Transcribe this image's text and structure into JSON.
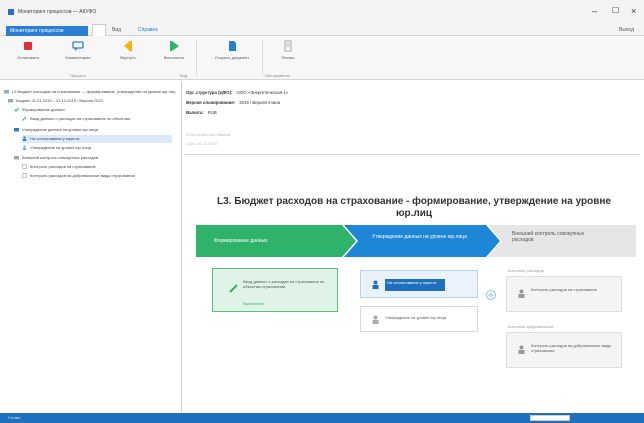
{
  "window": {
    "title": "Мониторинг процессов — АКУФО",
    "min_glyph": "–",
    "max_glyph": "☐",
    "close_glyph": "×"
  },
  "tabs": {
    "file": "Мониторинг процессов",
    "active": "",
    "view": "Вид",
    "help": "Справка",
    "right": "Выход"
  },
  "ribbon": {
    "buttons": [
      {
        "label": "Остановить",
        "icon": "stop-icon"
      },
      {
        "label": "Комментарии",
        "icon": "comment-icon"
      },
      {
        "label": "Вернуть",
        "icon": "back-icon"
      },
      {
        "label": "Выполнить",
        "icon": "play-icon"
      },
      {
        "label": "Открыть документ",
        "icon": "document-icon"
      },
      {
        "label": "Печать",
        "icon": "print-icon"
      }
    ],
    "groups": [
      "Процесс",
      "Вид",
      "Инструменты"
    ]
  },
  "tree": {
    "rows": [
      {
        "label": "L3 Бюджет расходов на страхование — формирование, утверждение на уровне юр.лиц",
        "icon": "folder-icon"
      },
      {
        "label": "Бюджет 01.01.2019 – 31.12.2019 / Версия ООО",
        "icon": "folder-icon"
      },
      {
        "label": "Формирование данных",
        "icon": "check-icon"
      },
      {
        "label": "Ввод данных о расходах на страхование по объектам",
        "icon": "pen-icon"
      },
      {
        "label": "Утверждение данных на уровне юр.лица",
        "icon": "folder-icon"
      },
      {
        "label": "На согласовании у юриста",
        "icon": "user-icon"
      },
      {
        "label": "Утверждение на уровне юр.лица",
        "icon": "user-icon"
      },
      {
        "label": "Внешний контроль совокупных расходов",
        "icon": "folder-icon"
      },
      {
        "label": "Контроль расходов на страхование",
        "icon": "doc-icon"
      },
      {
        "label": "Контроль расходов на добровольные виды страхования",
        "icon": "doc-icon"
      }
    ]
  },
  "info": {
    "rows": [
      {
        "key": "Орг. структура (ЦФО):",
        "value": "ООО «Энергетическая-1»"
      },
      {
        "key": "Версия планирования:",
        "value": "2019 / Версия плана"
      },
      {
        "key": "Валюта:",
        "value": "RUB"
      }
    ],
    "faint": [
      "Ответственный: Иванов",
      "Срок: 31.12.2019"
    ]
  },
  "diagram": {
    "title": "L3. Бюджет расходов на страхование - формирование, утверждение на уровне юр.лиц",
    "stages": [
      {
        "label": "Формирование данных",
        "color": "#2fb36a"
      },
      {
        "label": "Утверждение данных на уровне юр.лица",
        "color": "#1e86d6"
      },
      {
        "label": "Внешний контроль совокупных расходов",
        "color": "#e6e6e6"
      }
    ],
    "cards": {
      "green": {
        "title": "Ввод данных о расходах на страхование по объектам страхования",
        "sub": "Выполнено"
      },
      "blue1": {
        "title": "На согласовании у юриста"
      },
      "blue2": {
        "title": "Утверждение на уровне юр.лица"
      },
      "gray_head1": "Контроль расходов",
      "gray1": {
        "title": "Контроль расходов на страхование"
      },
      "gray_head2": "Контроль добровольных",
      "gray2": {
        "title": "Контроль расходов на добровольные виды страхования"
      }
    }
  },
  "status": {
    "left": "Готово",
    "right": ""
  }
}
